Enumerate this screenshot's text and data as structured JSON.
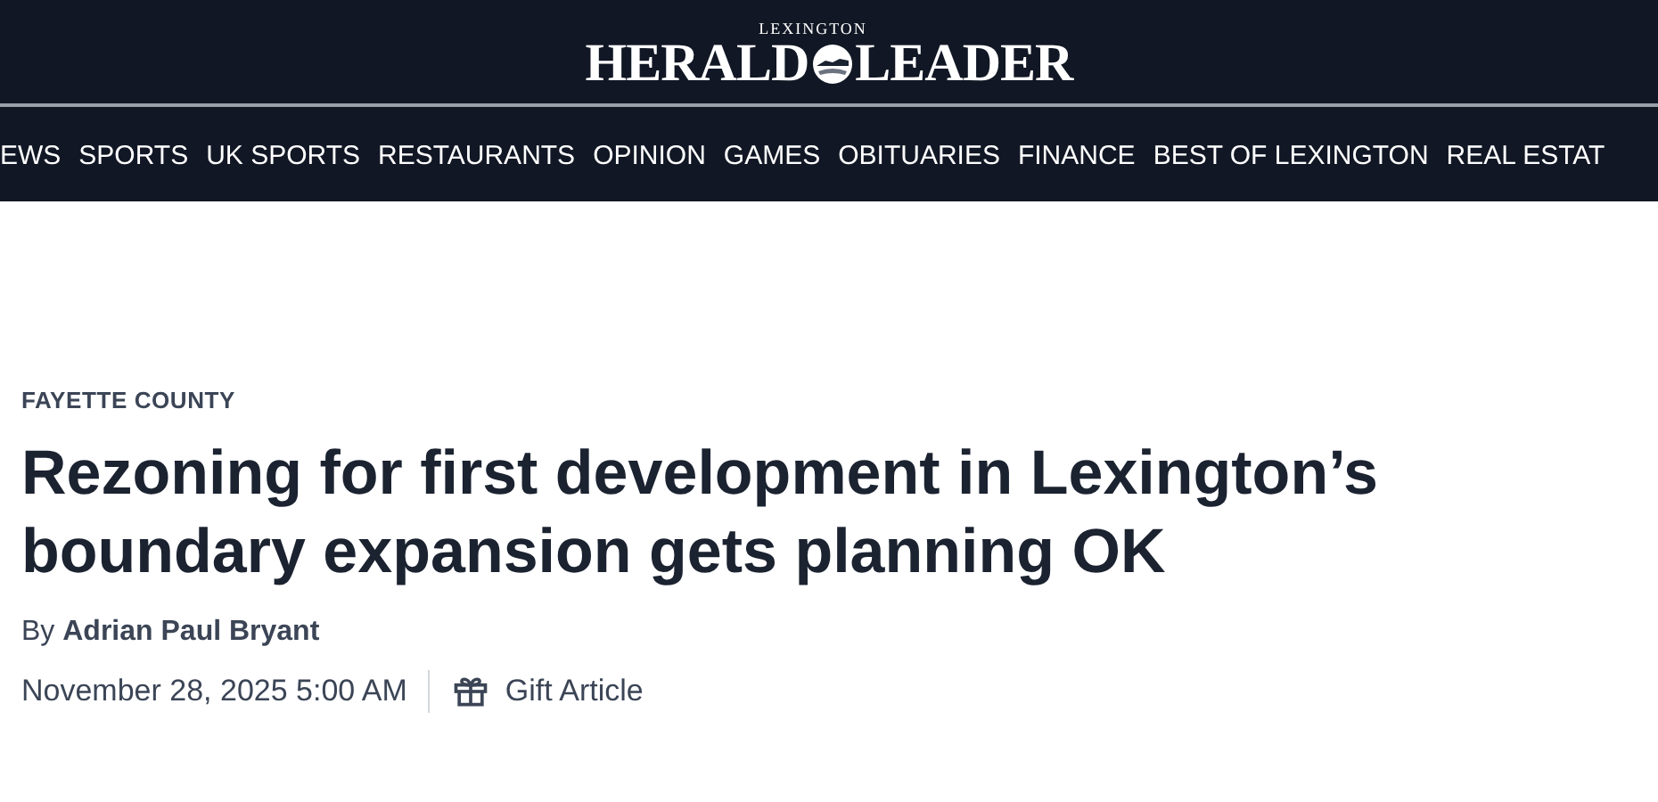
{
  "masthead": {
    "logo_top": "LEXINGTON",
    "logo_left": "HERALD",
    "logo_right": "LEADER"
  },
  "nav": [
    "EWS",
    "SPORTS",
    "UK SPORTS",
    "RESTAURANTS",
    "OPINION",
    "GAMES",
    "OBITUARIES",
    "FINANCE",
    "BEST OF LEXINGTON",
    "REAL ESTAT"
  ],
  "article": {
    "section": "FAYETTE COUNTY",
    "headline": "Rezoning for first development in Lexington’s boundary expansion gets planning OK",
    "byline": "By **Adrian Paul Bryant**",
    "date": "November 28, 2025 5:00 AM",
    "gift": "Gift Article"
  }
}
